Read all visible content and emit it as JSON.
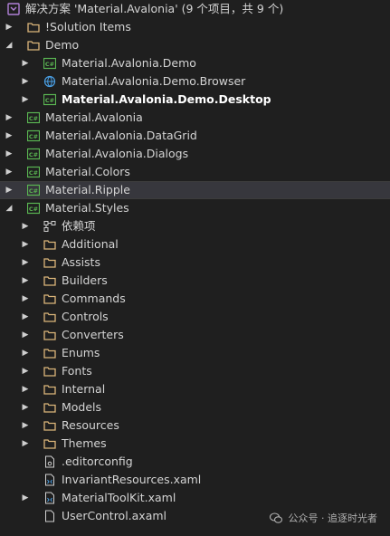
{
  "solution": {
    "label": "解决方案 'Material.Avalonia' (9 个项目，共 9 个)"
  },
  "items": [
    {
      "label": "!Solution Items"
    },
    {
      "label": "Demo"
    },
    {
      "label": "Material.Avalonia.Demo"
    },
    {
      "label": "Material.Avalonia.Demo.Browser"
    },
    {
      "label": "Material.Avalonia.Demo.Desktop"
    },
    {
      "label": "Material.Avalonia"
    },
    {
      "label": "Material.Avalonia.DataGrid"
    },
    {
      "label": "Material.Avalonia.Dialogs"
    },
    {
      "label": "Material.Colors"
    },
    {
      "label": "Material.Ripple"
    },
    {
      "label": "Material.Styles"
    },
    {
      "label": "依赖项"
    },
    {
      "label": "Additional"
    },
    {
      "label": "Assists"
    },
    {
      "label": "Builders"
    },
    {
      "label": "Commands"
    },
    {
      "label": "Controls"
    },
    {
      "label": "Converters"
    },
    {
      "label": "Enums"
    },
    {
      "label": "Fonts"
    },
    {
      "label": "Internal"
    },
    {
      "label": "Models"
    },
    {
      "label": "Resources"
    },
    {
      "label": "Themes"
    },
    {
      "label": ".editorconfig"
    },
    {
      "label": "InvariantResources.xaml"
    },
    {
      "label": "MaterialToolKit.xaml"
    },
    {
      "label": "UserControl.axaml"
    }
  ],
  "watermark": {
    "label": "公众号 · 追逐时光者"
  },
  "colors": {
    "accent": "#5ab552",
    "folder": "#dcb67a",
    "background": "#1f1f1f"
  }
}
